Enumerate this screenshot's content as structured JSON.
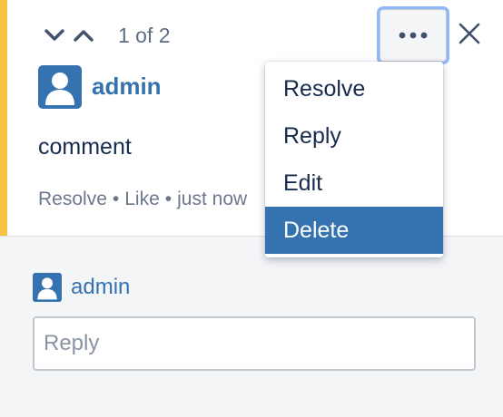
{
  "navigation": {
    "counter": "1 of 2",
    "prev_icon": "chevron-down-icon",
    "next_icon": "chevron-up-icon"
  },
  "comment": {
    "author": "admin",
    "avatar_icon": "user-avatar-icon",
    "body": "comment",
    "actions": [
      {
        "label": "Resolve"
      },
      {
        "label": "Like"
      },
      {
        "label": "just now"
      }
    ],
    "separator": "•"
  },
  "toolbar": {
    "more_icon": "more-options-icon",
    "close_icon": "close-icon"
  },
  "dropdown": {
    "items": [
      {
        "label": "Resolve",
        "active": false
      },
      {
        "label": "Reply",
        "active": false
      },
      {
        "label": "Edit",
        "active": false
      },
      {
        "label": "Delete",
        "active": true
      }
    ]
  },
  "reply": {
    "user": "admin",
    "placeholder": "Reply"
  },
  "colors": {
    "accent": "#f6c342",
    "link": "#3572b0",
    "menu_highlight": "#3572b0",
    "focus_ring": "#8fb7ff",
    "reply_background": "#f4f5f7"
  }
}
